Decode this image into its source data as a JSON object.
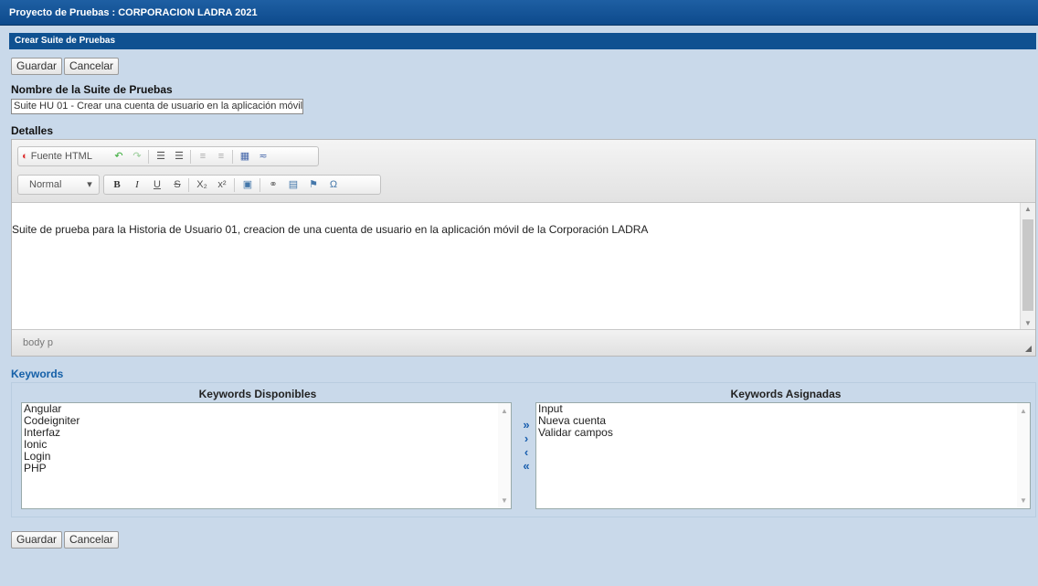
{
  "window": {
    "title": "Proyecto de Pruebas : CORPORACION LADRA 2021"
  },
  "section": {
    "title": "Crear Suite de Pruebas"
  },
  "buttons": {
    "save": "Guardar",
    "cancel": "Cancelar"
  },
  "form": {
    "name_label": "Nombre de la Suite de Pruebas",
    "name_value": "Suite HU 01 - Crear una cuenta de usuario en la aplicación móvil",
    "details_label": "Detalles"
  },
  "editor": {
    "toolbar": {
      "source": "Fuente HTML",
      "format": "Normal",
      "bold": "B",
      "italic": "I",
      "underline": "U",
      "strike": "S",
      "subscript": "X₂",
      "superscript": "x²",
      "special_char": "Ω"
    },
    "content": "Suite de prueba para la Historia de Usuario 01, creacion de una cuenta de usuario en la aplicación móvil de la Corporación LADRA",
    "status_path": "body  p"
  },
  "keywords": {
    "section_label": "Keywords",
    "available_header": "Keywords Disponibles",
    "assigned_header": "Keywords Asignadas",
    "available": [
      "Angular",
      "Codeigniter",
      "Interfaz",
      "Ionic",
      "Login",
      "PHP"
    ],
    "assigned": [
      "Input",
      "Nueva cuenta",
      "Validar campos"
    ],
    "icons": [
      "double-right-icon",
      "right-icon",
      "left-icon",
      "double-left-icon"
    ]
  },
  "colors": {
    "titlebar": "#1e5fa3",
    "section": "#0f5191",
    "page_bg": "#c9d9ea",
    "link": "#1560a8"
  }
}
